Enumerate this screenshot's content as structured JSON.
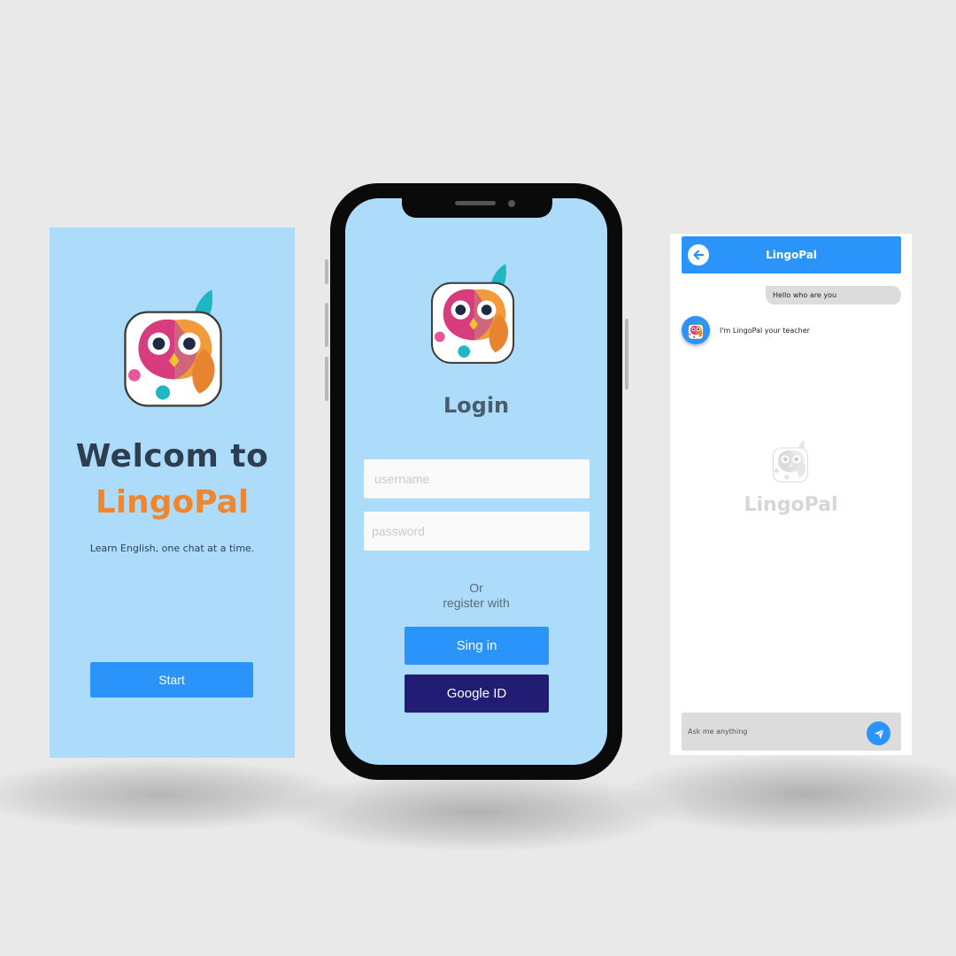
{
  "welcome": {
    "title": "Welcom to",
    "brand": "LingoPal",
    "tagline": "Learn English, one chat at a time.",
    "start_label": "Start"
  },
  "login": {
    "title": "Login",
    "username_placeholder": "username",
    "password_placeholder": "password",
    "or_line1": "Or",
    "or_line2": "register with",
    "signin_label": "Sing in",
    "google_label": "Google ID"
  },
  "chat": {
    "title": "LingoPal",
    "user_message": "Hello who are you",
    "bot_message": "I'm LingoPal your teacher",
    "watermark": "LingoPal",
    "input_placeholder": "Ask me anything"
  },
  "icons": {
    "logo": "owl-logo-icon",
    "back": "back-arrow-icon",
    "send": "send-icon"
  },
  "colors": {
    "primary": "#2a94fb",
    "dark_button": "#221c74",
    "screen_background": "#addcfb",
    "brand_orange": "#f0872f",
    "title_dark": "#2c3e50"
  }
}
